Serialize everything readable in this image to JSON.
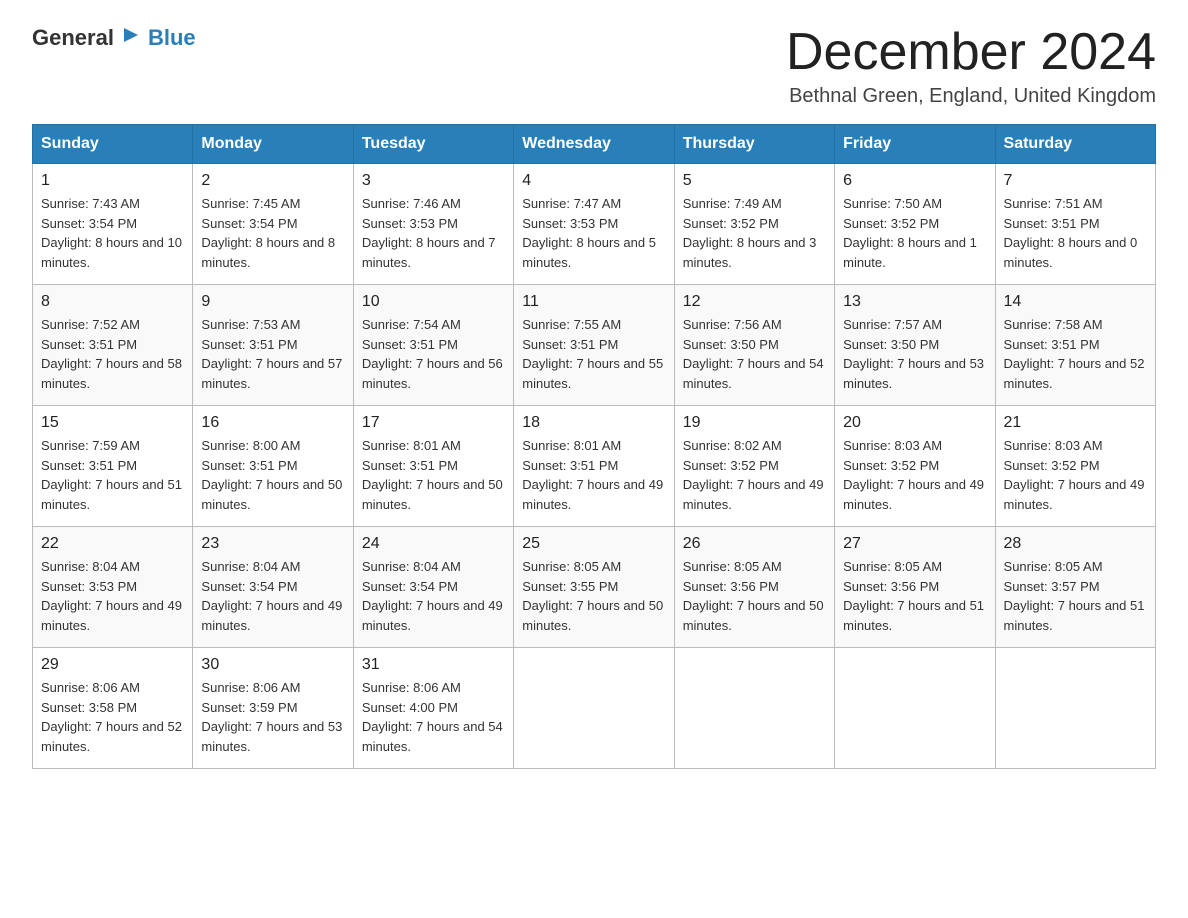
{
  "header": {
    "logo_general": "General",
    "logo_blue": "Blue",
    "month_title": "December 2024",
    "location": "Bethnal Green, England, United Kingdom"
  },
  "days_of_week": [
    "Sunday",
    "Monday",
    "Tuesday",
    "Wednesday",
    "Thursday",
    "Friday",
    "Saturday"
  ],
  "weeks": [
    [
      {
        "day": "1",
        "sunrise": "7:43 AM",
        "sunset": "3:54 PM",
        "daylight": "8 hours and 10 minutes."
      },
      {
        "day": "2",
        "sunrise": "7:45 AM",
        "sunset": "3:54 PM",
        "daylight": "8 hours and 8 minutes."
      },
      {
        "day": "3",
        "sunrise": "7:46 AM",
        "sunset": "3:53 PM",
        "daylight": "8 hours and 7 minutes."
      },
      {
        "day": "4",
        "sunrise": "7:47 AM",
        "sunset": "3:53 PM",
        "daylight": "8 hours and 5 minutes."
      },
      {
        "day": "5",
        "sunrise": "7:49 AM",
        "sunset": "3:52 PM",
        "daylight": "8 hours and 3 minutes."
      },
      {
        "day": "6",
        "sunrise": "7:50 AM",
        "sunset": "3:52 PM",
        "daylight": "8 hours and 1 minute."
      },
      {
        "day": "7",
        "sunrise": "7:51 AM",
        "sunset": "3:51 PM",
        "daylight": "8 hours and 0 minutes."
      }
    ],
    [
      {
        "day": "8",
        "sunrise": "7:52 AM",
        "sunset": "3:51 PM",
        "daylight": "7 hours and 58 minutes."
      },
      {
        "day": "9",
        "sunrise": "7:53 AM",
        "sunset": "3:51 PM",
        "daylight": "7 hours and 57 minutes."
      },
      {
        "day": "10",
        "sunrise": "7:54 AM",
        "sunset": "3:51 PM",
        "daylight": "7 hours and 56 minutes."
      },
      {
        "day": "11",
        "sunrise": "7:55 AM",
        "sunset": "3:51 PM",
        "daylight": "7 hours and 55 minutes."
      },
      {
        "day": "12",
        "sunrise": "7:56 AM",
        "sunset": "3:50 PM",
        "daylight": "7 hours and 54 minutes."
      },
      {
        "day": "13",
        "sunrise": "7:57 AM",
        "sunset": "3:50 PM",
        "daylight": "7 hours and 53 minutes."
      },
      {
        "day": "14",
        "sunrise": "7:58 AM",
        "sunset": "3:51 PM",
        "daylight": "7 hours and 52 minutes."
      }
    ],
    [
      {
        "day": "15",
        "sunrise": "7:59 AM",
        "sunset": "3:51 PM",
        "daylight": "7 hours and 51 minutes."
      },
      {
        "day": "16",
        "sunrise": "8:00 AM",
        "sunset": "3:51 PM",
        "daylight": "7 hours and 50 minutes."
      },
      {
        "day": "17",
        "sunrise": "8:01 AM",
        "sunset": "3:51 PM",
        "daylight": "7 hours and 50 minutes."
      },
      {
        "day": "18",
        "sunrise": "8:01 AM",
        "sunset": "3:51 PM",
        "daylight": "7 hours and 49 minutes."
      },
      {
        "day": "19",
        "sunrise": "8:02 AM",
        "sunset": "3:52 PM",
        "daylight": "7 hours and 49 minutes."
      },
      {
        "day": "20",
        "sunrise": "8:03 AM",
        "sunset": "3:52 PM",
        "daylight": "7 hours and 49 minutes."
      },
      {
        "day": "21",
        "sunrise": "8:03 AM",
        "sunset": "3:52 PM",
        "daylight": "7 hours and 49 minutes."
      }
    ],
    [
      {
        "day": "22",
        "sunrise": "8:04 AM",
        "sunset": "3:53 PM",
        "daylight": "7 hours and 49 minutes."
      },
      {
        "day": "23",
        "sunrise": "8:04 AM",
        "sunset": "3:54 PM",
        "daylight": "7 hours and 49 minutes."
      },
      {
        "day": "24",
        "sunrise": "8:04 AM",
        "sunset": "3:54 PM",
        "daylight": "7 hours and 49 minutes."
      },
      {
        "day": "25",
        "sunrise": "8:05 AM",
        "sunset": "3:55 PM",
        "daylight": "7 hours and 50 minutes."
      },
      {
        "day": "26",
        "sunrise": "8:05 AM",
        "sunset": "3:56 PM",
        "daylight": "7 hours and 50 minutes."
      },
      {
        "day": "27",
        "sunrise": "8:05 AM",
        "sunset": "3:56 PM",
        "daylight": "7 hours and 51 minutes."
      },
      {
        "day": "28",
        "sunrise": "8:05 AM",
        "sunset": "3:57 PM",
        "daylight": "7 hours and 51 minutes."
      }
    ],
    [
      {
        "day": "29",
        "sunrise": "8:06 AM",
        "sunset": "3:58 PM",
        "daylight": "7 hours and 52 minutes."
      },
      {
        "day": "30",
        "sunrise": "8:06 AM",
        "sunset": "3:59 PM",
        "daylight": "7 hours and 53 minutes."
      },
      {
        "day": "31",
        "sunrise": "8:06 AM",
        "sunset": "4:00 PM",
        "daylight": "7 hours and 54 minutes."
      },
      null,
      null,
      null,
      null
    ]
  ]
}
